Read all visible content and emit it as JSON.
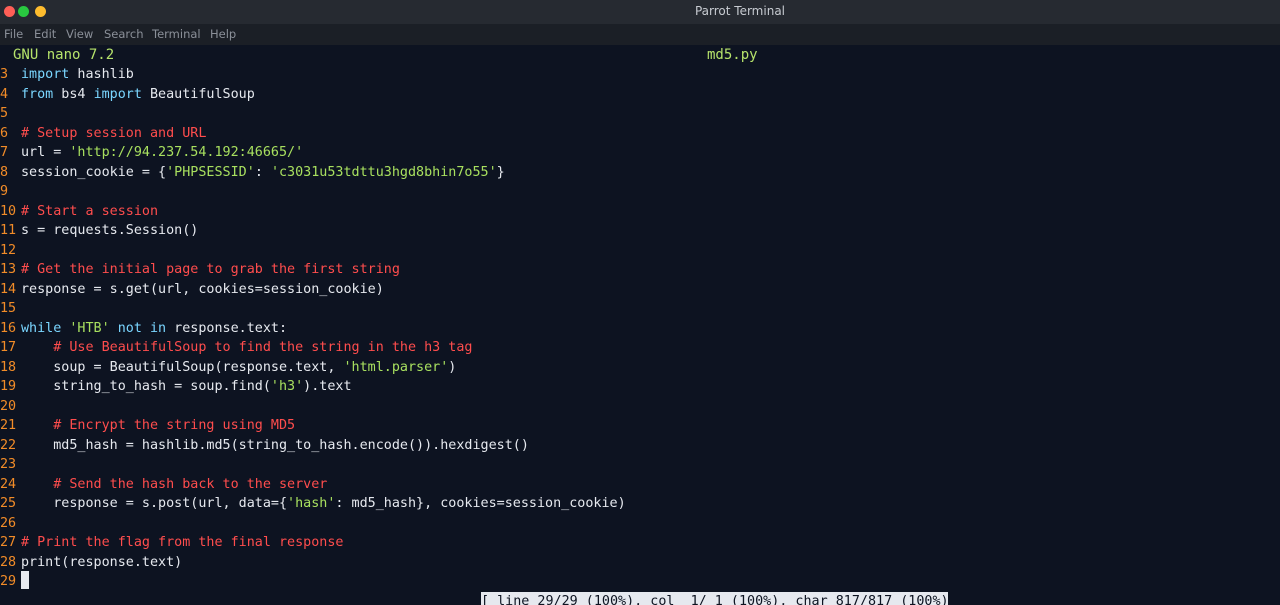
{
  "window": {
    "title": "Parrot Terminal"
  },
  "menu": [
    "File",
    "Edit",
    "View",
    "Search",
    "Terminal",
    "Help"
  ],
  "nano": {
    "version": "GNU nano 7.2",
    "filename": "md5.py"
  },
  "lines": [
    {
      "n": "3",
      "indent": "",
      "tokens": [
        {
          "t": "kw",
          "v": "import"
        },
        {
          "t": "plain",
          "v": " hashlib"
        }
      ]
    },
    {
      "n": "4",
      "indent": "",
      "tokens": [
        {
          "t": "kw",
          "v": "from"
        },
        {
          "t": "plain",
          "v": " bs4 "
        },
        {
          "t": "kw",
          "v": "import"
        },
        {
          "t": "plain",
          "v": " BeautifulSoup"
        }
      ]
    },
    {
      "n": "5",
      "indent": "",
      "tokens": []
    },
    {
      "n": "6",
      "indent": "",
      "tokens": [
        {
          "t": "cmt",
          "v": "# Setup session and URL"
        }
      ]
    },
    {
      "n": "7",
      "indent": "",
      "tokens": [
        {
          "t": "plain",
          "v": "url = "
        },
        {
          "t": "str",
          "v": "'http://94.237.54.192:46665/'"
        }
      ]
    },
    {
      "n": "8",
      "indent": "",
      "tokens": [
        {
          "t": "plain",
          "v": "session_cookie = {"
        },
        {
          "t": "str",
          "v": "'PHPSESSID'"
        },
        {
          "t": "plain",
          "v": ": "
        },
        {
          "t": "str",
          "v": "'c3031u53tdttu3hgd8bhin7o55'"
        },
        {
          "t": "plain",
          "v": "}"
        }
      ]
    },
    {
      "n": "9",
      "indent": "",
      "tokens": []
    },
    {
      "n": "10",
      "indent": "",
      "tokens": [
        {
          "t": "cmt",
          "v": "# Start a session"
        }
      ]
    },
    {
      "n": "11",
      "indent": "",
      "tokens": [
        {
          "t": "plain",
          "v": "s = requests.Session()"
        }
      ]
    },
    {
      "n": "12",
      "indent": "",
      "tokens": []
    },
    {
      "n": "13",
      "indent": "",
      "tokens": [
        {
          "t": "cmt",
          "v": "# Get the initial page to grab the first string"
        }
      ]
    },
    {
      "n": "14",
      "indent": "",
      "tokens": [
        {
          "t": "plain",
          "v": "response = s.get(url, cookies=session_cookie)"
        }
      ]
    },
    {
      "n": "15",
      "indent": "",
      "tokens": []
    },
    {
      "n": "16",
      "indent": "",
      "tokens": [
        {
          "t": "kw",
          "v": "while"
        },
        {
          "t": "plain",
          "v": " "
        },
        {
          "t": "str",
          "v": "'HTB'"
        },
        {
          "t": "plain",
          "v": " "
        },
        {
          "t": "kw",
          "v": "not in"
        },
        {
          "t": "plain",
          "v": " response.text:"
        }
      ]
    },
    {
      "n": "17",
      "indent": "    ",
      "tokens": [
        {
          "t": "cmt",
          "v": "# Use BeautifulSoup to find the string in the h3 tag"
        }
      ]
    },
    {
      "n": "18",
      "indent": "    ",
      "tokens": [
        {
          "t": "plain",
          "v": "soup = BeautifulSoup(response.text, "
        },
        {
          "t": "str",
          "v": "'html.parser'"
        },
        {
          "t": "plain",
          "v": ")"
        }
      ]
    },
    {
      "n": "19",
      "indent": "    ",
      "tokens": [
        {
          "t": "plain",
          "v": "string_to_hash = soup.find("
        },
        {
          "t": "str",
          "v": "'h3'"
        },
        {
          "t": "plain",
          "v": ").text"
        }
      ]
    },
    {
      "n": "20",
      "indent": "",
      "tokens": []
    },
    {
      "n": "21",
      "indent": "    ",
      "tokens": [
        {
          "t": "cmt",
          "v": "# Encrypt the string using MD5"
        }
      ]
    },
    {
      "n": "22",
      "indent": "    ",
      "tokens": [
        {
          "t": "plain",
          "v": "md5_hash = hashlib.md5(string_to_hash.encode()).hexdigest()"
        }
      ]
    },
    {
      "n": "23",
      "indent": "",
      "tokens": []
    },
    {
      "n": "24",
      "indent": "    ",
      "tokens": [
        {
          "t": "cmt",
          "v": "# Send the hash back to the server"
        }
      ]
    },
    {
      "n": "25",
      "indent": "    ",
      "tokens": [
        {
          "t": "plain",
          "v": "response = s.post(url, data={"
        },
        {
          "t": "str",
          "v": "'hash'"
        },
        {
          "t": "plain",
          "v": ": md5_hash}, cookies=session_cookie)"
        }
      ]
    },
    {
      "n": "26",
      "indent": "",
      "tokens": []
    },
    {
      "n": "27",
      "indent": "",
      "tokens": [
        {
          "t": "cmt",
          "v": "# Print the flag from the final response"
        }
      ]
    },
    {
      "n": "28",
      "indent": "",
      "tokens": [
        {
          "t": "plain",
          "v": "print(response.text)"
        }
      ]
    },
    {
      "n": "29",
      "indent": "",
      "tokens": []
    }
  ],
  "status": "[ line 29/29 (100%), col  1/ 1 (100%), char 817/817 (100%) ]",
  "colors": {
    "background": "#0d1321",
    "line_number": "#f28c28",
    "keyword": "#7ad6ff",
    "string": "#a8e05f",
    "comment": "#ff4d4d",
    "header": "#b6e36b"
  }
}
